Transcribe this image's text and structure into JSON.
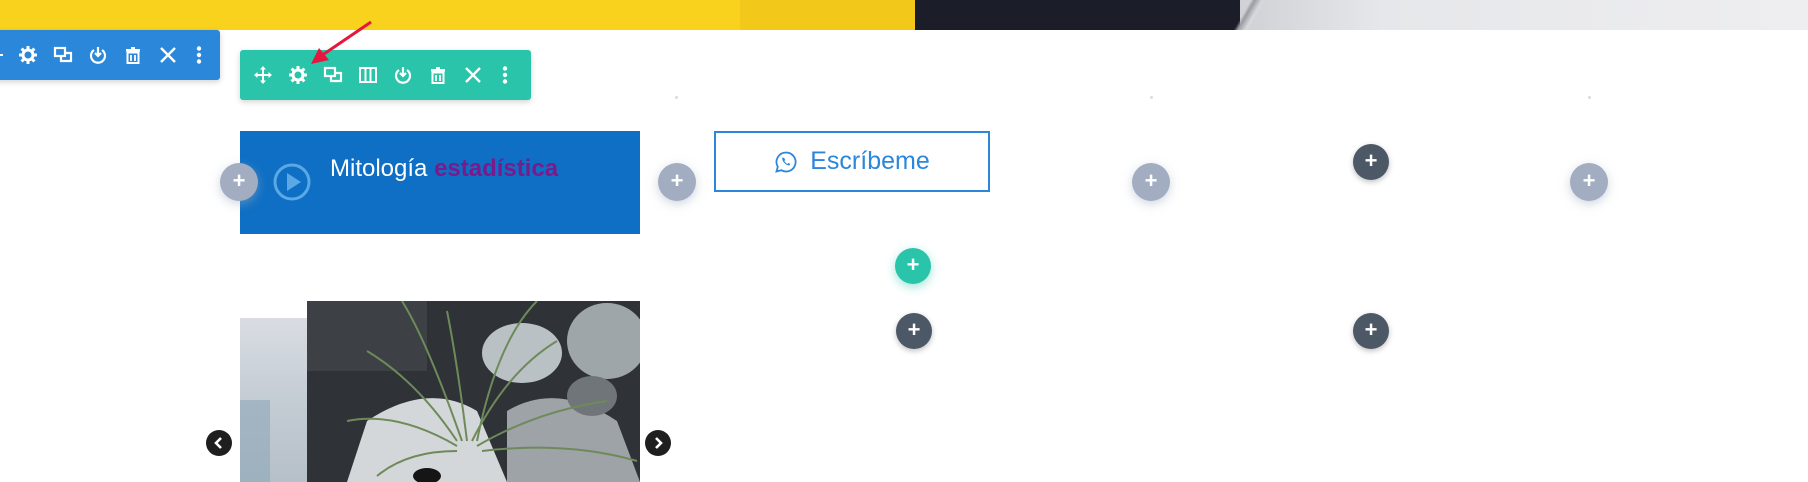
{
  "module": {
    "title_part1": "Mitología",
    "title_part2": "estadística"
  },
  "whatsapp_button": {
    "label": "Escríbeme"
  },
  "add_button": {
    "glyph": "+"
  },
  "colors": {
    "section_toolbar": "#2b87da",
    "row_toolbar": "#29c4a9",
    "module_background": "#0f6fc4",
    "accent_text": "#7a1b8c",
    "banner_yellow": "#f8d21c",
    "banner_dark": "#1b1d28",
    "arrow": "#e5173f"
  },
  "section_toolbar_icons": [
    "move-icon",
    "gear-icon",
    "duplicate-icon",
    "save-icon",
    "trash-icon",
    "close-icon",
    "more-icon"
  ],
  "row_toolbar_icons": [
    "move-icon",
    "gear-icon",
    "duplicate-icon",
    "columns-icon",
    "save-icon",
    "trash-icon",
    "close-icon",
    "more-icon"
  ]
}
